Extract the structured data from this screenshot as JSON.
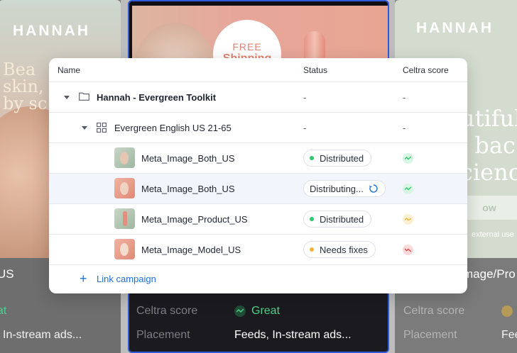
{
  "background": {
    "left_card": {
      "brand": "HANNAH",
      "headline_lines": [
        "Bea",
        "skin,",
        "by sc"
      ],
      "title_fragment": "US",
      "score_fragment": "at",
      "placement_fragment": "In-stream ads..."
    },
    "center_card": {
      "badge_line1": "FREE",
      "badge_line2": "Shipping",
      "score_label": "Celtra score",
      "score_value": "Great",
      "placement_label": "Placement",
      "placement_value": "Feeds, In-stream ads..."
    },
    "right_card": {
      "brand": "HANNAH",
      "headline_lines": [
        "utiful",
        ", bac",
        "cience"
      ],
      "button_fragment": "ow",
      "note": "external use",
      "title_fragment": "mage/Pro",
      "score_label": "Celtra score",
      "placement_label": "Placement",
      "placement_fragment": "Fee"
    }
  },
  "table": {
    "headers": {
      "name": "Name",
      "status": "Status",
      "score": "Celtra score"
    },
    "rows": [
      {
        "type": "folder",
        "name": "Hannah - Evergreen Toolkit",
        "status": "-",
        "score": "-"
      },
      {
        "type": "campaign",
        "name": "Evergreen English US 21-65",
        "status": "-",
        "score": "-"
      },
      {
        "type": "asset",
        "name": "Meta_Image_Both_US",
        "status": "Distributed",
        "status_color": "#2fc76f",
        "score_level": "great"
      },
      {
        "type": "asset",
        "name": "Meta_Image_Both_US",
        "status": "Distributing...",
        "status_color": "#1c6fd6",
        "score_level": "great",
        "selected": true
      },
      {
        "type": "asset",
        "name": "Meta_Image_Product_US",
        "status": "Distributed",
        "status_color": "#2fc76f",
        "score_level": "ok"
      },
      {
        "type": "asset",
        "name": "Meta_Image_Model_US",
        "status": "Needs fixes",
        "status_color": "#f3b33d",
        "score_level": "poor"
      }
    ],
    "link_campaign": "Link campaign"
  },
  "colors": {
    "accent": "#1c6fd6",
    "great": "#2fc76f",
    "ok": "#f3b33d",
    "poor": "#e5484d"
  }
}
